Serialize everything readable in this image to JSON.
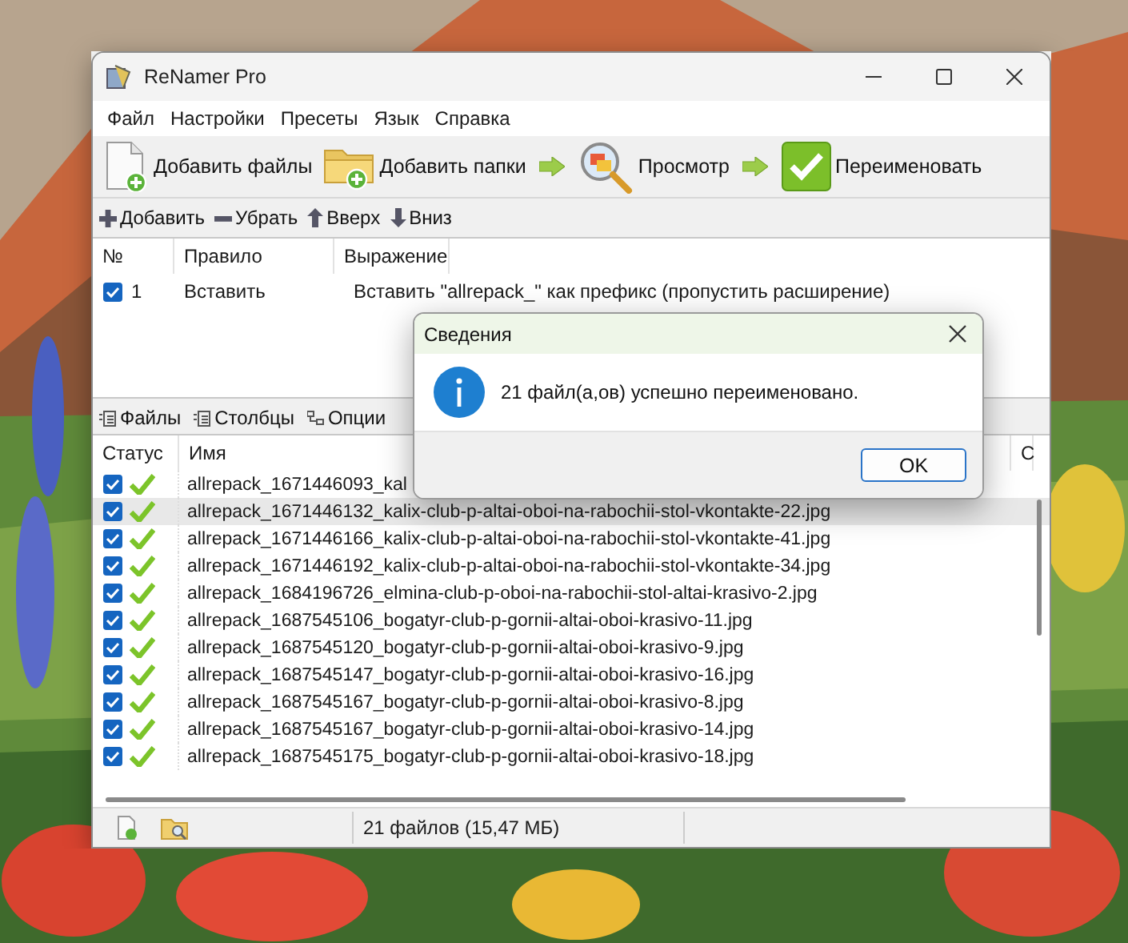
{
  "window": {
    "title": "ReNamer Pro"
  },
  "menu": [
    "Файл",
    "Настройки",
    "Пресеты",
    "Язык",
    "Справка"
  ],
  "toolbar": [
    {
      "kind": "add-files",
      "label": "Добавить файлы",
      "arrow_before": false
    },
    {
      "kind": "add-folders",
      "label": "Добавить папки",
      "arrow_before": false
    },
    {
      "kind": "preview",
      "label": "Просмотр",
      "arrow_before": true
    },
    {
      "kind": "rename",
      "label": "Переименовать",
      "arrow_before": true
    }
  ],
  "rules_toolbar": [
    {
      "kind": "add",
      "label": "Добавить"
    },
    {
      "kind": "remove",
      "label": "Убрать"
    },
    {
      "kind": "up",
      "label": "Вверх"
    },
    {
      "kind": "down",
      "label": "Вниз"
    }
  ],
  "rules_table": {
    "columns": [
      "№",
      "Правило",
      "Выражение"
    ],
    "rows": [
      {
        "checked": true,
        "number": "1",
        "rule": "Вставить",
        "expression": "Вставить \"allrepack_\" как префикс (пропустить расширение)"
      }
    ]
  },
  "file_tabs": [
    {
      "kind": "files",
      "label": "Файлы"
    },
    {
      "kind": "columns",
      "label": "Столбцы"
    },
    {
      "kind": "options",
      "label": "Опции"
    }
  ],
  "files_table": {
    "columns": [
      "Статус",
      "Имя",
      "С"
    ],
    "rows": [
      {
        "checked": true,
        "renamed": true,
        "selected": false,
        "name": "allrepack_1671446093_kal"
      },
      {
        "checked": true,
        "renamed": true,
        "selected": true,
        "name": "allrepack_1671446132_kalix-club-p-altai-oboi-na-rabochii-stol-vkontakte-22.jpg"
      },
      {
        "checked": true,
        "renamed": true,
        "selected": false,
        "name": "allrepack_1671446166_kalix-club-p-altai-oboi-na-rabochii-stol-vkontakte-41.jpg"
      },
      {
        "checked": true,
        "renamed": true,
        "selected": false,
        "name": "allrepack_1671446192_kalix-club-p-altai-oboi-na-rabochii-stol-vkontakte-34.jpg"
      },
      {
        "checked": true,
        "renamed": true,
        "selected": false,
        "name": "allrepack_1684196726_elmina-club-p-oboi-na-rabochii-stol-altai-krasivo-2.jpg"
      },
      {
        "checked": true,
        "renamed": true,
        "selected": false,
        "name": "allrepack_1687545106_bogatyr-club-p-gornii-altai-oboi-krasivo-11.jpg"
      },
      {
        "checked": true,
        "renamed": true,
        "selected": false,
        "name": "allrepack_1687545120_bogatyr-club-p-gornii-altai-oboi-krasivo-9.jpg"
      },
      {
        "checked": true,
        "renamed": true,
        "selected": false,
        "name": "allrepack_1687545147_bogatyr-club-p-gornii-altai-oboi-krasivo-16.jpg"
      },
      {
        "checked": true,
        "renamed": true,
        "selected": false,
        "name": "allrepack_1687545167_bogatyr-club-p-gornii-altai-oboi-krasivo-8.jpg"
      },
      {
        "checked": true,
        "renamed": true,
        "selected": false,
        "name": "allrepack_1687545167_bogatyr-club-p-gornii-altai-oboi-krasivo-14.jpg"
      },
      {
        "checked": true,
        "renamed": true,
        "selected": false,
        "name": "allrepack_1687545175_bogatyr-club-p-gornii-altai-oboi-krasivo-18.jpg"
      }
    ]
  },
  "status_bar": {
    "text": "21 файлов (15,47 МБ)"
  },
  "dialog": {
    "title": "Сведения",
    "message": "21 файл(а,ов) успешно переименовано.",
    "button": "OK"
  }
}
